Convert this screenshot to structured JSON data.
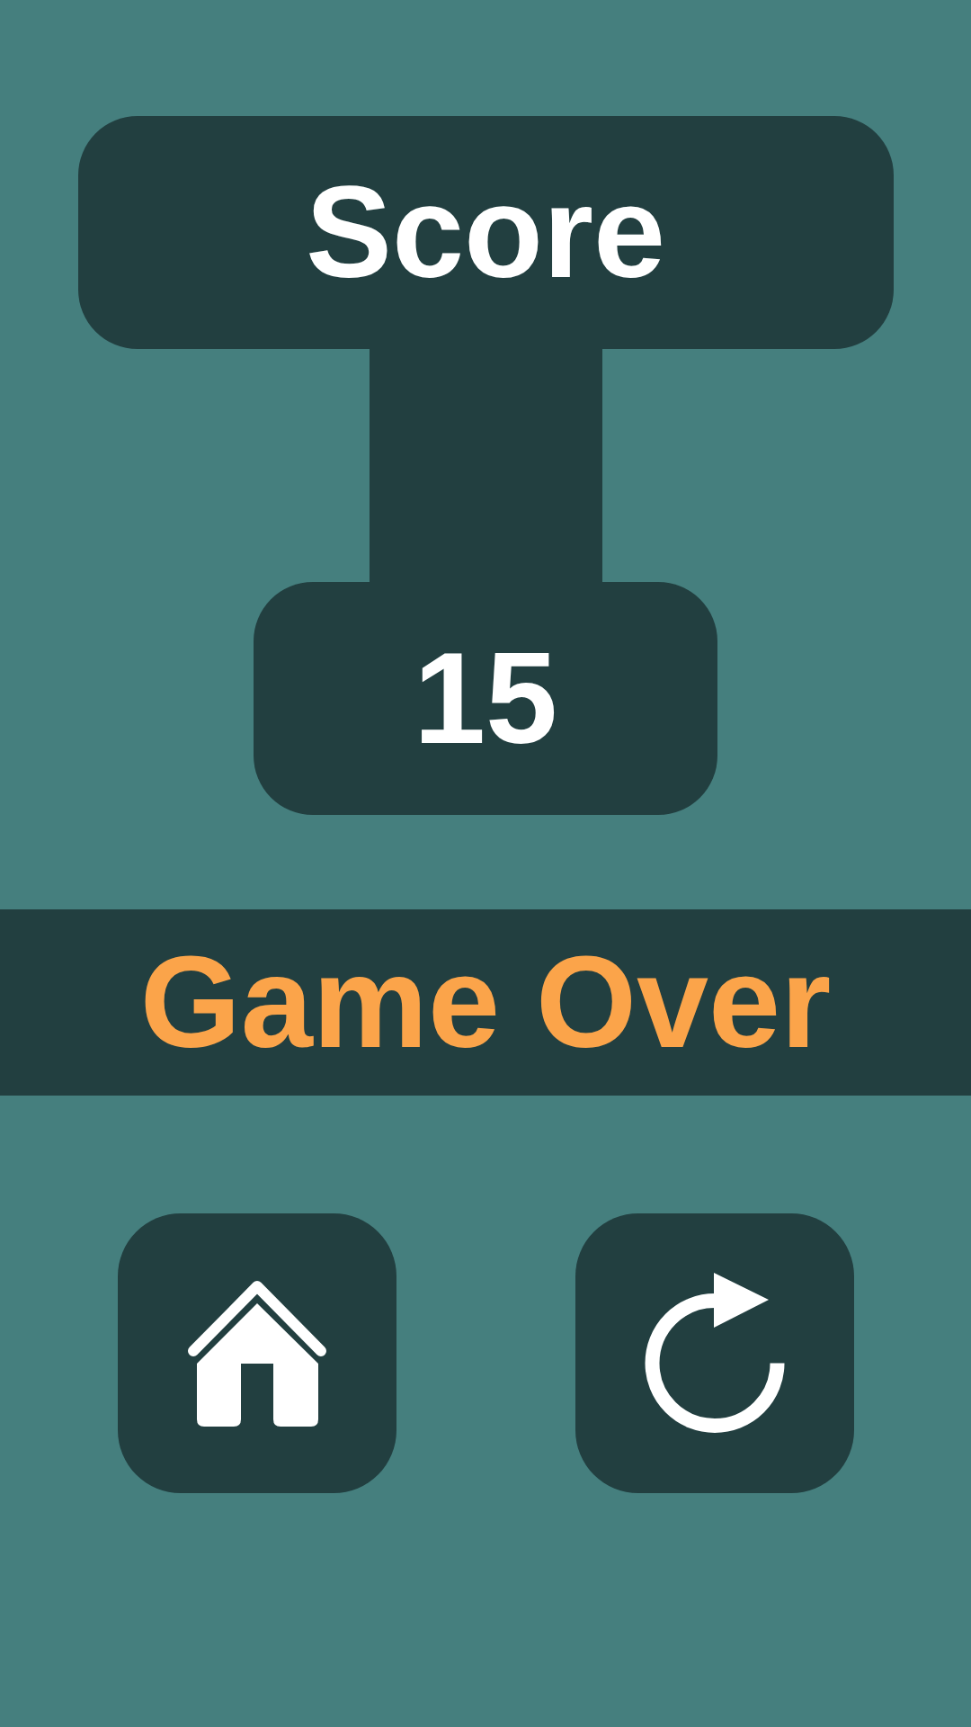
{
  "score_board": {
    "title": "Score",
    "value": "15"
  },
  "banner": {
    "text": "Game Over"
  },
  "buttons": [
    {
      "kind": "home"
    },
    {
      "kind": "replay"
    }
  ]
}
